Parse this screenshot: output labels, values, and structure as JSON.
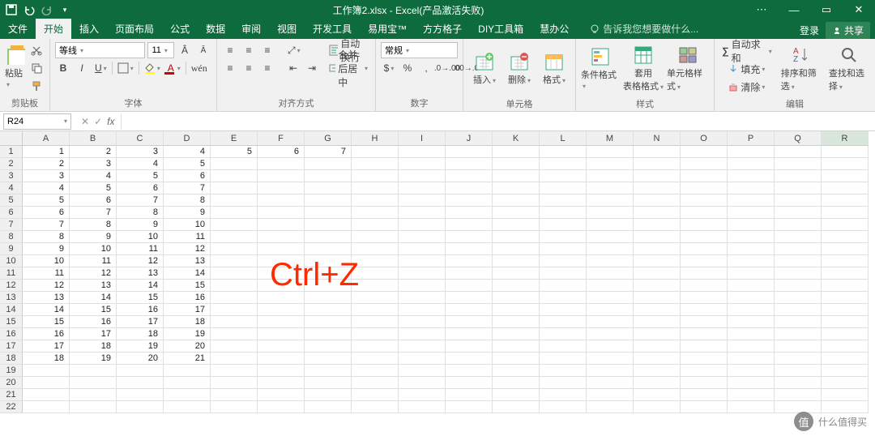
{
  "title": "工作簿2.xlsx - Excel(产品激活失败)",
  "win": {
    "min": "—",
    "max": "▭",
    "close": "✕",
    "opts": "⋯"
  },
  "tabs": [
    "文件",
    "开始",
    "插入",
    "页面布局",
    "公式",
    "数据",
    "审阅",
    "视图",
    "开发工具",
    "易用宝™",
    "方方格子",
    "DIY工具箱",
    "慧办公"
  ],
  "active_tab": 1,
  "tell_me": "告诉我您想要做什么...",
  "login": "登录",
  "share": "共享",
  "groups": {
    "clipboard": {
      "label": "剪贴板",
      "paste": "粘贴"
    },
    "font": {
      "label": "字体",
      "name": "等线",
      "size": "11"
    },
    "align": {
      "label": "对齐方式",
      "wrap": "自动换行",
      "merge": "合并后居中"
    },
    "number": {
      "label": "数字",
      "format": "常规"
    },
    "cells": {
      "label": "单元格",
      "insert": "插入",
      "delete": "删除",
      "format": "格式"
    },
    "styles": {
      "label": "样式",
      "cond": "条件格式",
      "tbl": "套用\n表格格式",
      "cell": "单元格样式"
    },
    "editing": {
      "label": "编辑",
      "sum": "自动求和",
      "fill": "填充",
      "clear": "清除",
      "sort": "排序和筛选",
      "find": "查找和选择"
    }
  },
  "namebox": "R24",
  "columns": [
    "A",
    "B",
    "C",
    "D",
    "E",
    "F",
    "G",
    "H",
    "I",
    "J",
    "K",
    "L",
    "M",
    "N",
    "O",
    "P",
    "Q",
    "R"
  ],
  "rows": 22,
  "data": {
    "1": {
      "A": "1",
      "B": "2",
      "C": "3",
      "D": "4",
      "E": "5",
      "F": "6",
      "G": "7"
    },
    "2": {
      "A": "2",
      "B": "3",
      "C": "4",
      "D": "5"
    },
    "3": {
      "A": "3",
      "B": "4",
      "C": "5",
      "D": "6"
    },
    "4": {
      "A": "4",
      "B": "5",
      "C": "6",
      "D": "7"
    },
    "5": {
      "A": "5",
      "B": "6",
      "C": "7",
      "D": "8"
    },
    "6": {
      "A": "6",
      "B": "7",
      "C": "8",
      "D": "9"
    },
    "7": {
      "A": "7",
      "B": "8",
      "C": "9",
      "D": "10"
    },
    "8": {
      "A": "8",
      "B": "9",
      "C": "10",
      "D": "11"
    },
    "9": {
      "A": "9",
      "B": "10",
      "C": "11",
      "D": "12"
    },
    "10": {
      "A": "10",
      "B": "11",
      "C": "12",
      "D": "13"
    },
    "11": {
      "A": "11",
      "B": "12",
      "C": "13",
      "D": "14"
    },
    "12": {
      "A": "12",
      "B": "13",
      "C": "14",
      "D": "15"
    },
    "13": {
      "A": "13",
      "B": "14",
      "C": "15",
      "D": "16"
    },
    "14": {
      "A": "14",
      "B": "15",
      "C": "16",
      "D": "17"
    },
    "15": {
      "A": "15",
      "B": "16",
      "C": "17",
      "D": "18"
    },
    "16": {
      "A": "16",
      "B": "17",
      "C": "18",
      "D": "19"
    },
    "17": {
      "A": "17",
      "B": "18",
      "C": "19",
      "D": "20"
    },
    "18": {
      "A": "18",
      "B": "19",
      "C": "20",
      "D": "21"
    }
  },
  "overlay": "Ctrl+Z",
  "watermark": "什么值得买",
  "watermark_badge": "值"
}
